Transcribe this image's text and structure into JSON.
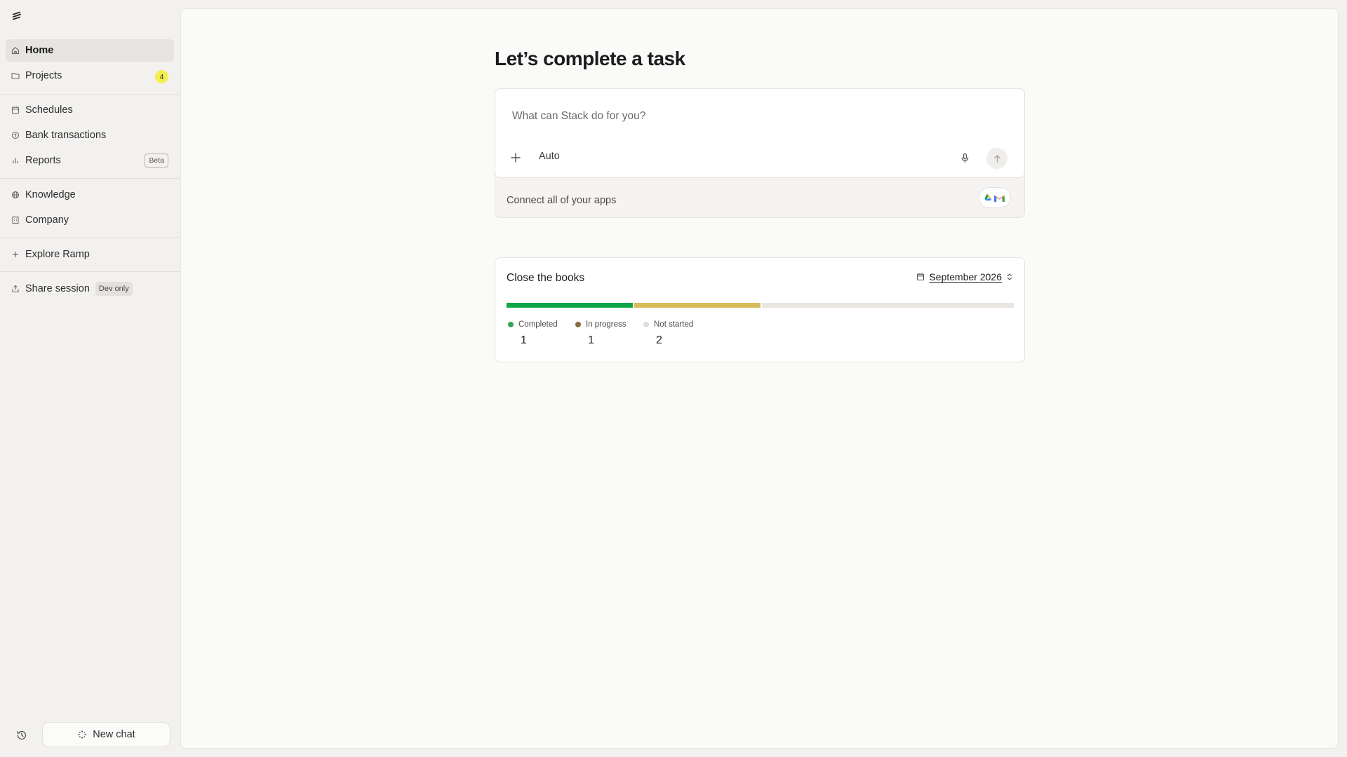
{
  "sidebar": {
    "items": [
      {
        "label": "Home",
        "icon": "home-icon"
      },
      {
        "label": "Projects",
        "icon": "folder-icon",
        "count": "4"
      },
      {
        "label": "Schedules",
        "icon": "calendar-icon"
      },
      {
        "label": "Bank transactions",
        "icon": "bank-icon"
      },
      {
        "label": "Reports",
        "icon": "bar-chart-icon",
        "badge": "Beta"
      },
      {
        "label": "Knowledge",
        "icon": "globe-icon"
      },
      {
        "label": "Company",
        "icon": "building-icon"
      },
      {
        "label": "Explore Ramp",
        "icon": "plus-icon"
      },
      {
        "label": "Share session",
        "icon": "share-icon",
        "badge": "Dev only"
      }
    ],
    "new_chat_label": "New chat"
  },
  "main": {
    "title": "Let’s complete a task",
    "composer": {
      "placeholder": "What can Stack do for you?",
      "mode": "Auto",
      "connect_label": "Connect all of your apps"
    },
    "books": {
      "title": "Close the books",
      "period": "September 2026",
      "statuses": [
        {
          "label": "Completed",
          "count": "1",
          "color": "#0fa64a"
        },
        {
          "label": "In progress",
          "count": "1",
          "color": "#d4bd5a"
        },
        {
          "label": "Not started",
          "count": "2",
          "color": "#e9e6e2"
        }
      ],
      "legend_dot_colors": [
        "#3aa357",
        "#8a6a38",
        "#e2dfdb"
      ]
    }
  },
  "colors": {
    "sidebar_bg": "#f2f1ef",
    "panel_bg": "#fafaf9",
    "active_item_bg": "#e6e4e1",
    "projects_badge": "#f4ee52"
  }
}
